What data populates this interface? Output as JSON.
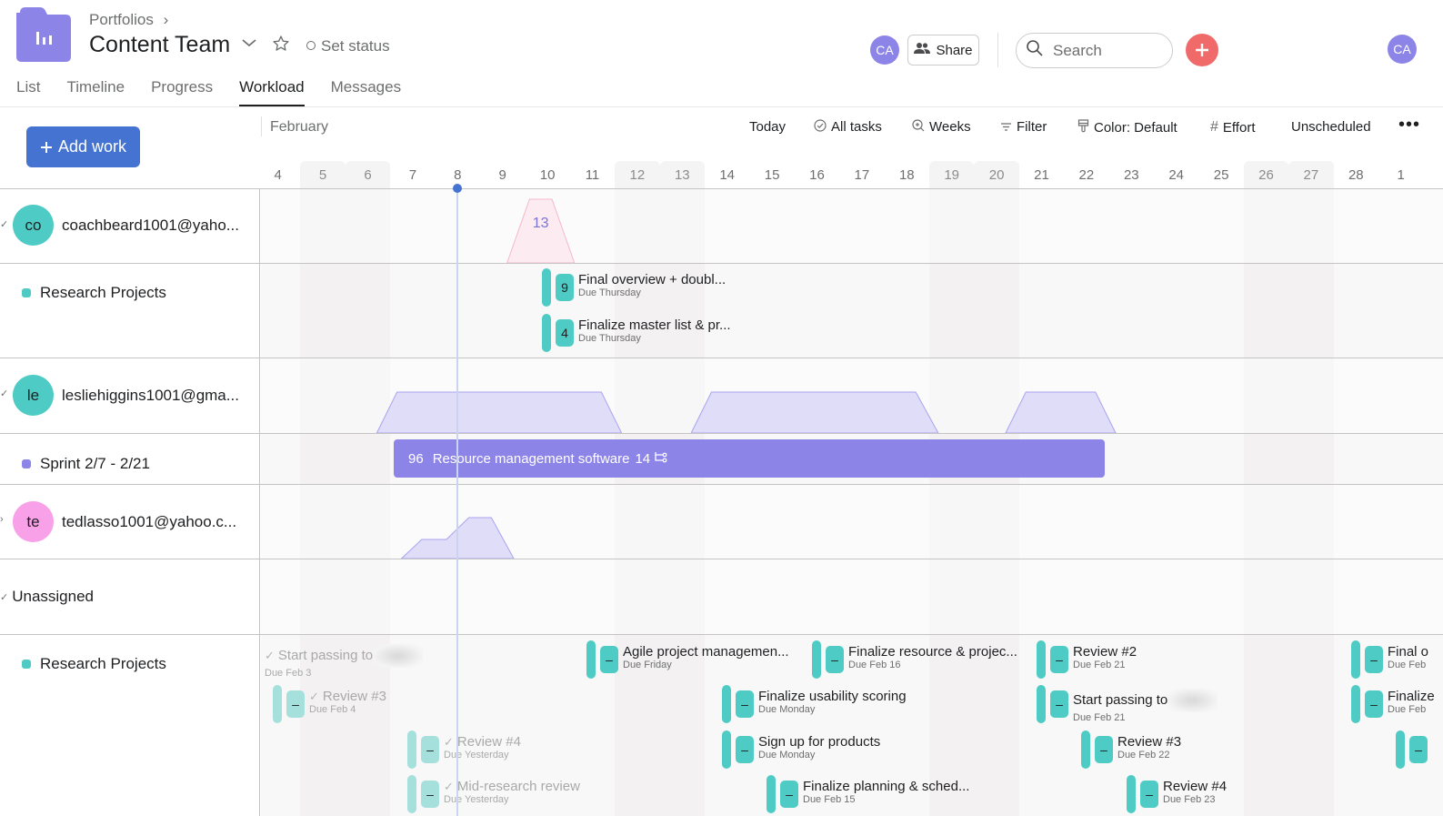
{
  "header": {
    "breadcrumb": "Portfolios",
    "breadcrumb_sep": "›",
    "title": "Content Team",
    "set_status": "Set status",
    "tabs": [
      {
        "label": "List",
        "active": false
      },
      {
        "label": "Timeline",
        "active": false
      },
      {
        "label": "Progress",
        "active": false
      },
      {
        "label": "Workload",
        "active": true
      },
      {
        "label": "Messages",
        "active": false
      }
    ],
    "member_avatar": "CA",
    "share_label": "Share",
    "search_placeholder": "Search",
    "user_avatar": "CA"
  },
  "toolbar": {
    "add_work_label": "Add work",
    "month": "February",
    "today_label": "Today",
    "all_tasks_label": "All tasks",
    "weeks_label": "Weeks",
    "filter_label": "Filter",
    "color_label": "Color: Default",
    "effort_label": "Effort",
    "unscheduled_label": "Unscheduled",
    "more_label": "•••"
  },
  "calendar": {
    "days": [
      "4",
      "5",
      "6",
      "7",
      "8",
      "9",
      "10",
      "11",
      "12",
      "13",
      "14",
      "15",
      "16",
      "17",
      "18",
      "19",
      "20",
      "21",
      "22",
      "23",
      "24",
      "25",
      "26",
      "27",
      "28",
      "1"
    ],
    "weekend_indices": [
      1,
      2,
      8,
      9,
      15,
      16,
      22,
      23
    ],
    "today_index": 4
  },
  "colors": {
    "accent": "#4573d2",
    "teal": "#4ecbc4",
    "purple": "#8d84e8",
    "pink": "#f8a1e8",
    "red": "#f06a6a",
    "workload_fill": "#e0ddf8",
    "workload_stroke": "#a9a3f0"
  },
  "people": [
    {
      "initials": "co",
      "name": "coachbeard1001@yaho...",
      "avatar_color": "#4ecbc4",
      "expanded": true,
      "workload": {
        "peak_label": "13",
        "over_capacity": true
      },
      "project": {
        "name": "Research Projects",
        "color": "#4ecbc4",
        "tasks": [
          {
            "effort": "9",
            "name": "Final overview + doubl...",
            "due": "Due Thursday"
          },
          {
            "effort": "4",
            "name": "Finalize master list & pr...",
            "due": "Due Thursday"
          }
        ]
      }
    },
    {
      "initials": "le",
      "name": "lesliehiggins1001@gma...",
      "avatar_color": "#4ecbc4",
      "expanded": true,
      "project": {
        "name": "Sprint 2/7 - 2/21",
        "color": "#8d84e8",
        "bar": {
          "effort": "96",
          "name": "Resource management software",
          "subtasks": "14"
        }
      }
    },
    {
      "initials": "te",
      "name": "tedlasso1001@yahoo.c...",
      "avatar_color": "#f8a1e8",
      "expanded": false
    }
  ],
  "unassigned": {
    "label": "Unassigned",
    "project": {
      "name": "Research Projects",
      "color": "#4ecbc4",
      "tasks": [
        {
          "effort": "–",
          "name": "Start passing to",
          "due": "Due Feb 3",
          "completed": true,
          "blurred": true
        },
        {
          "effort": "–",
          "name": "Review #3",
          "due": "Due Feb 4",
          "completed": true
        },
        {
          "effort": "–",
          "name": "Review #4",
          "due": "Due Yesterday",
          "completed": true
        },
        {
          "effort": "–",
          "name": "Mid-research review",
          "due": "Due Yesterday",
          "completed": true
        },
        {
          "effort": "–",
          "name": "Agile project managemen...",
          "due": "Due Friday",
          "completed": false
        },
        {
          "effort": "–",
          "name": "Finalize resource & projec...",
          "due": "Due Feb 16",
          "completed": false
        },
        {
          "effort": "–",
          "name": "Finalize usability scoring",
          "due": "Due Monday",
          "completed": false
        },
        {
          "effort": "–",
          "name": "Sign up for products",
          "due": "Due Monday",
          "completed": false
        },
        {
          "effort": "–",
          "name": "Finalize planning & sched...",
          "due": "Due Feb 15",
          "completed": false
        },
        {
          "effort": "–",
          "name": "Review #2",
          "due": "Due Feb 21",
          "completed": false
        },
        {
          "effort": "–",
          "name": "Start passing to",
          "due": "Due Feb 21",
          "completed": false,
          "blurred": true
        },
        {
          "effort": "–",
          "name": "Review #3",
          "due": "Due Feb 22",
          "completed": false
        },
        {
          "effort": "–",
          "name": "Review #4",
          "due": "Due Feb 23",
          "completed": false
        },
        {
          "effort": "–",
          "name": "Final o",
          "due": "Due Feb",
          "completed": false
        },
        {
          "effort": "–",
          "name": "Finalize",
          "due": "Due Feb",
          "completed": false
        },
        {
          "effort": "–",
          "name": "",
          "due": "",
          "completed": false
        }
      ]
    }
  }
}
